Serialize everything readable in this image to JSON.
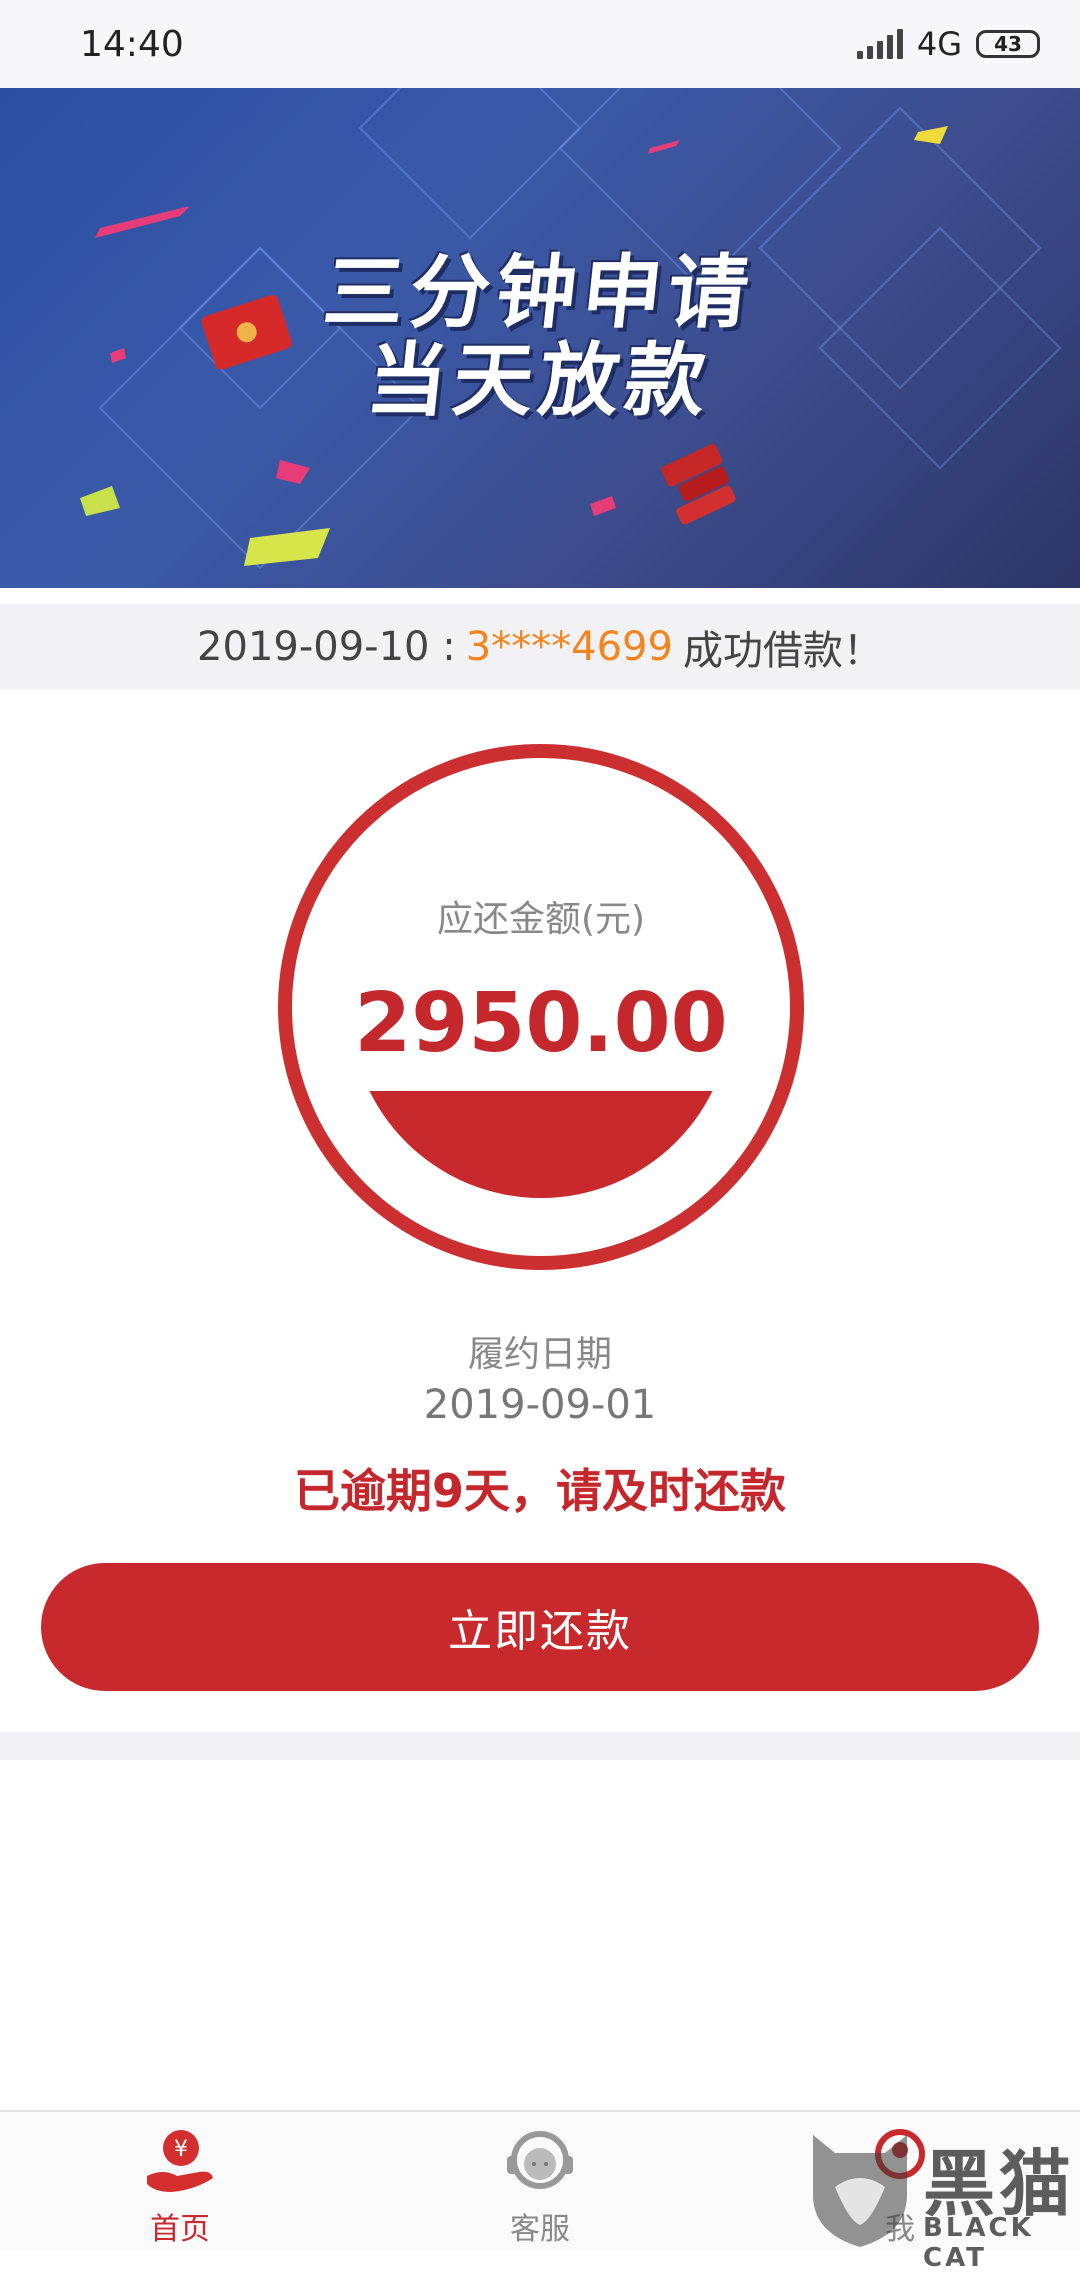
{
  "status_bar": {
    "time": "14:40",
    "network": "4G",
    "battery": "43"
  },
  "banner": {
    "line1": "三分钟申请",
    "line2": "当天放款"
  },
  "notice": {
    "date": "2019-09-10 :",
    "phone": "3****4699",
    "message": "成功借款！"
  },
  "repayment": {
    "label": "应还金额(元)",
    "amount": "2950.00",
    "due_label": "履约日期",
    "due_date": "2019-09-01",
    "overdue_text": "已逾期9天，请及时还款",
    "button_label": "立即还款",
    "fill_fraction": 0.28,
    "accent_color": "#c8292c"
  },
  "tabs": [
    {
      "label": "首页",
      "icon": "home-yuan-icon",
      "active": true
    },
    {
      "label": "客服",
      "icon": "customer-service-icon",
      "active": false
    },
    {
      "label": "我",
      "icon": "profile-icon",
      "active": false
    }
  ],
  "watermark": {
    "text_cn": "黑猫",
    "text_en": "BLACK CAT"
  }
}
